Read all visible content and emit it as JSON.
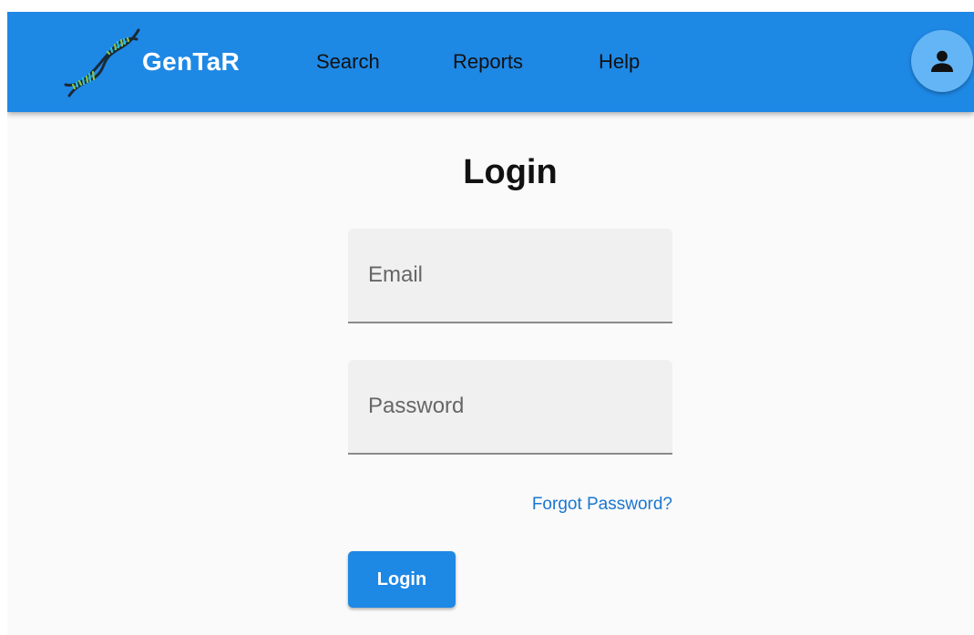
{
  "header": {
    "brand_name": "GenTaR",
    "nav": {
      "search": "Search",
      "reports": "Reports",
      "help": "Help"
    },
    "account_icon": "person-icon",
    "logo_icon": "dna-helix-icon"
  },
  "login": {
    "title": "Login",
    "email_placeholder": "Email",
    "password_placeholder": "Password",
    "forgot_password": "Forgot Password?",
    "submit_label": "Login"
  },
  "colors": {
    "primary": "#1e88e5",
    "avatar_background": "#64b5f6",
    "link": "#1976d2",
    "field_background": "#f0f0f0",
    "page_background": "#fafafa"
  }
}
